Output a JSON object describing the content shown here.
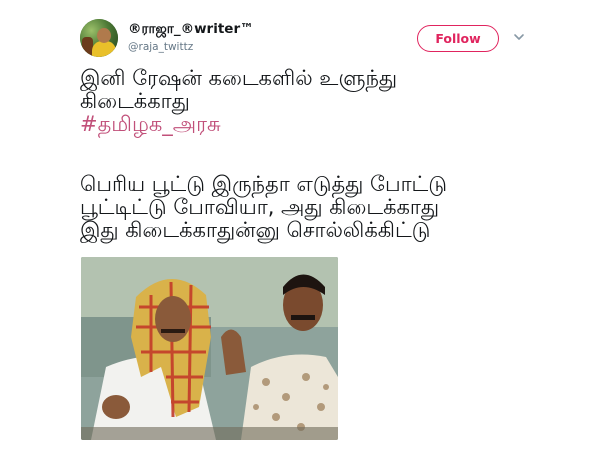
{
  "tweet": {
    "author": {
      "display_name": "®ராஜா_®writer™",
      "handle": "@raja_twittz"
    },
    "follow_label": "Follow",
    "text_lines": [
      "இனி ரேஷன் கடைகளில் உளுந்து",
      "கிடைக்காது"
    ],
    "hashtag": "#தமிழக_அரசு",
    "text_lines_2": [
      "பெரிய பூட்டு இருந்தா எடுத்து போட்டு",
      "பூட்டிட்டு போவியா, அது கிடைக்காது",
      "இது கிடைக்காதுன்னு சொல்லிக்கிட்டு"
    ],
    "media": {
      "description_icon": "meme-photo"
    },
    "colors": {
      "accent": "#e0245e",
      "hashtag": "#c1507a",
      "handle": "#657786",
      "text": "#14171a"
    }
  }
}
